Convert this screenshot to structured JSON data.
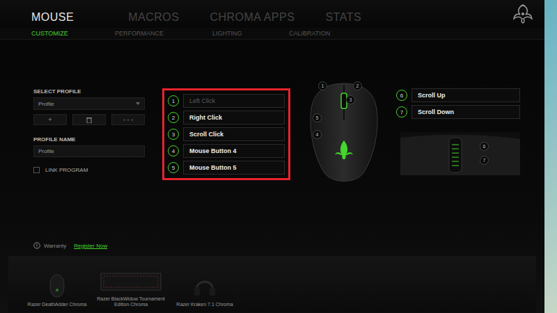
{
  "nav_tabs": [
    {
      "label": "MOUSE",
      "selected": true
    },
    {
      "label": "MACROS",
      "selected": false
    },
    {
      "label": "CHROMA APPS",
      "selected": false
    },
    {
      "label": "STATS",
      "selected": false
    }
  ],
  "sub_tabs": [
    {
      "label": "CUSTOMIZE",
      "selected": true
    },
    {
      "label": "PERFORMANCE",
      "selected": false
    },
    {
      "label": "LIGHTING",
      "selected": false
    },
    {
      "label": "CALIBRATION",
      "selected": false
    }
  ],
  "profile": {
    "select_label": "SELECT PROFILE",
    "dropdown_value": "Profile",
    "buttons": [
      "+",
      "- - -"
    ],
    "name_label": "PROFILE NAME",
    "name_value": "Profile",
    "link_program": {
      "label": "LINK PROGRAM",
      "checked": false
    }
  },
  "buttons": [
    {
      "number": "1",
      "label": "Left Click",
      "disabled": true
    },
    {
      "number": "2",
      "label": "Right Click",
      "disabled": false
    },
    {
      "number": "3",
      "label": "Scroll Click",
      "disabled": false
    },
    {
      "number": "4",
      "label": "Mouse Button 4",
      "disabled": false
    },
    {
      "number": "5",
      "label": "Mouse Button 5",
      "disabled": false
    }
  ],
  "scroll_buttons": [
    {
      "number": "6",
      "label": "Scroll Up",
      "disabled": false
    },
    {
      "number": "7",
      "label": "Scroll Down",
      "disabled": false
    }
  ],
  "mouse_callouts": [
    "1",
    "2",
    "3",
    "5",
    "4"
  ],
  "side_callouts": [
    "6",
    "7"
  ],
  "warranty": {
    "label": "Warranty",
    "link": "Register Now"
  },
  "devices": [
    {
      "name": "Razer DeathAdder Chroma",
      "kind": "mouse"
    },
    {
      "name": "Razer BlackWidow Tournament Edition Chroma",
      "kind": "keyboard"
    },
    {
      "name": "Razer Kraken 7.1 Chroma",
      "kind": "headset"
    }
  ]
}
